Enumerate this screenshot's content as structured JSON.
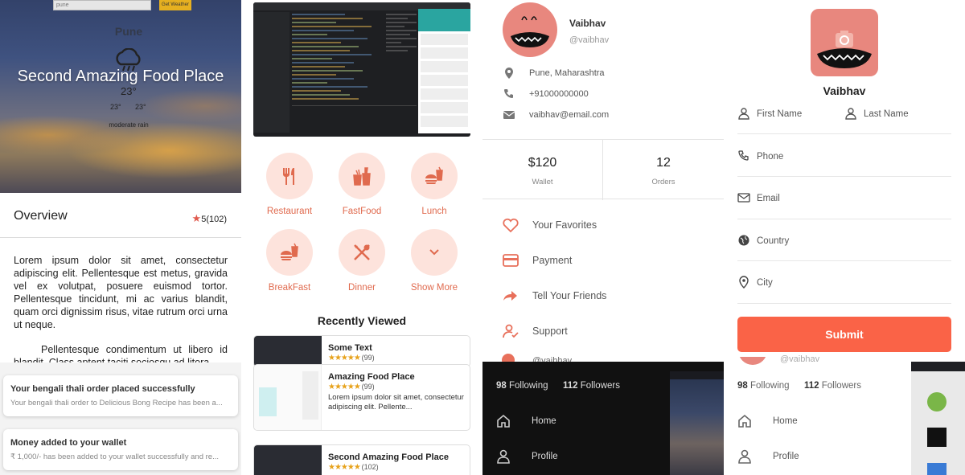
{
  "colors": {
    "accent": "#fa6347",
    "accent_soft": "#fde3dc",
    "accent_text": "#e06a4e",
    "star": "#e7a21b",
    "dark_drawer": "#111111"
  },
  "weather": {
    "search_value": "pune",
    "get_button": "Get Weather",
    "city": "Pune",
    "title": "Second Amazing Food Place",
    "temp": "23°",
    "min": "23°",
    "max": "23°",
    "description": "moderate rain"
  },
  "overview": {
    "title": "Overview",
    "rating": "5",
    "rating_count": "(102)",
    "paragraph1": "Lorem ipsum dolor sit amet, consectetur adipiscing elit. Pellentesque est metus, gravida vel ex volutpat, posuere euismod tortor. Pellentesque tincidunt, mi ac varius blandit, quam orci dignissim risus, vitae rutrum orci urna ut neque.",
    "paragraph2": "Pellentesque condimentum ut libero id blandit. Class aptent taciti sociosqu ad litora"
  },
  "notifications": [
    {
      "title": "Your bengali thali order placed successfully",
      "body": "Your bengali thali order to Delicious Bong Recipe has been a..."
    },
    {
      "title": "Money added to your wallet",
      "body": "₹ 1,000/- has been added to your wallet successfully and re..."
    }
  ],
  "categories": [
    {
      "label": "Restaurant",
      "icon": "utensils-icon"
    },
    {
      "label": "FastFood",
      "icon": "fastfood-icon"
    },
    {
      "label": "Lunch",
      "icon": "burger-drink-icon"
    },
    {
      "label": "BreakFast",
      "icon": "burger-drink-icon"
    },
    {
      "label": "Dinner",
      "icon": "fork-spoon-icon"
    },
    {
      "label": "Show More",
      "icon": "chevron-down-icon"
    }
  ],
  "recently_viewed": {
    "title": "Recently Viewed",
    "items": [
      {
        "name": "Some Text",
        "stars": "★★★★★",
        "count": "(99)",
        "desc": ""
      },
      {
        "name": "Amazing Food Place",
        "stars": "★★★★★",
        "count": "(99)",
        "desc": "Lorem ipsum dolor sit amet, consectetur adipiscing elit. Pellente..."
      },
      {
        "name": "Second Amazing Food Place",
        "stars": "★★★★★",
        "count": "(102)",
        "desc": ""
      }
    ]
  },
  "profile": {
    "name": "Vaibhav",
    "handle": "@vaibhav",
    "location": "Pune, Maharashtra",
    "phone": "+91000000000",
    "email": "vaibhav@email.com",
    "wallet_value": "$120",
    "wallet_label": "Wallet",
    "orders_value": "12",
    "orders_label": "Orders",
    "menu": [
      {
        "label": "Your Favorites",
        "icon": "heart-icon"
      },
      {
        "label": "Payment",
        "icon": "card-icon"
      },
      {
        "label": "Tell Your Friends",
        "icon": "share-icon"
      },
      {
        "label": "Support",
        "icon": "support-icon"
      }
    ],
    "partial_handle": "@vaibhav"
  },
  "drawer": {
    "following_count": "98",
    "following_label": "Following",
    "followers_count": "112",
    "followers_label": "Followers",
    "items": [
      {
        "label": "Home",
        "icon": "home-icon"
      },
      {
        "label": "Profile",
        "icon": "person-icon"
      }
    ]
  },
  "form": {
    "name": "Vaibhav",
    "first_name": "First Name",
    "last_name": "Last Name",
    "phone": "Phone",
    "email": "Email",
    "country": "Country",
    "city": "City",
    "submit": "Submit"
  }
}
